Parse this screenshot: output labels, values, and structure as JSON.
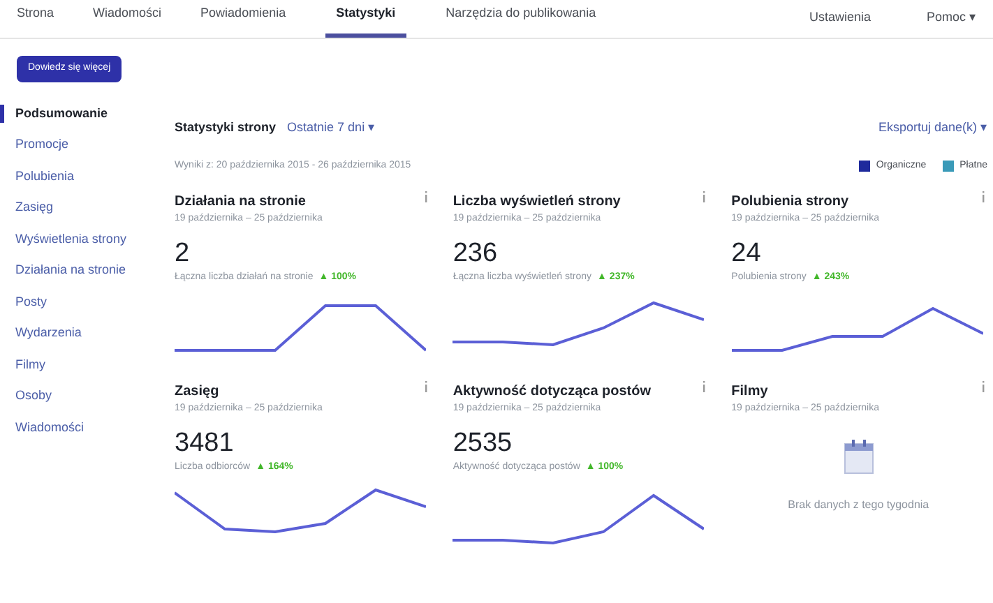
{
  "nav": {
    "tabs": [
      {
        "label": "Strona",
        "selected": false
      },
      {
        "label": "Wiadomości",
        "selected": false
      },
      {
        "label": "Powiadomienia",
        "selected": false
      },
      {
        "label": "Statystyki",
        "selected": true
      },
      {
        "label": "Narzędzia do publikowania",
        "selected": false
      }
    ],
    "right": [
      "Ustawienia",
      "Pomoc ▾"
    ]
  },
  "learn_more_button": "Dowiedz się więcej",
  "sidebar": {
    "items": [
      {
        "label": "Podsumowanie",
        "selected": true
      },
      {
        "label": "Promocje",
        "selected": false
      },
      {
        "label": "Polubienia",
        "selected": false
      },
      {
        "label": "Zasięg",
        "selected": false
      },
      {
        "label": "Wyświetlenia strony",
        "selected": false
      },
      {
        "label": "Działania na stronie",
        "selected": false
      },
      {
        "label": "Posty",
        "selected": false
      },
      {
        "label": "Wydarzenia",
        "selected": false
      },
      {
        "label": "Filmy",
        "selected": false
      },
      {
        "label": "Osoby",
        "selected": false
      },
      {
        "label": "Wiadomości",
        "selected": false
      }
    ]
  },
  "header": {
    "title": "Statystyki strony",
    "period": "Ostatnie 7 dni ▾",
    "export": "Eksportuj dane(k) ▾"
  },
  "date_range": "Wyniki z: 20 października 2015 - 26 października 2015",
  "legend": [
    {
      "label": "Organiczne",
      "color": "#1e2a9c"
    },
    {
      "label": "Płatne",
      "color": "#3a9ab8"
    }
  ],
  "cards": [
    {
      "kind": "sparkline",
      "title": "Działania na stronie",
      "dates": "19 października – 25 października",
      "value": "2",
      "caption": "Łączna liczba działań na stronie",
      "change": "▲ 100%"
    },
    {
      "kind": "sparkline",
      "title": "Liczba wyświetleń strony",
      "dates": "19 października – 25 października",
      "value": "236",
      "caption": "Łączna liczba wyświetleń strony",
      "change": "▲ 237%"
    },
    {
      "kind": "sparkline",
      "title": "Polubienia strony",
      "dates": "19 października – 25 października",
      "value": "24",
      "caption": "Polubienia strony",
      "change": "▲ 243%"
    },
    {
      "kind": "sparkline",
      "title": "Zasięg",
      "dates": "19 października – 25 października",
      "value": "3481",
      "caption": "Liczba odbiorców",
      "change": "▲ 164%"
    },
    {
      "kind": "sparkline",
      "title": "Aktywność dotycząca postów",
      "dates": "19 października – 25 października",
      "value": "2535",
      "caption": "Aktywność dotycząca postów",
      "change": "▲ 100%"
    },
    {
      "kind": "empty",
      "title": "Filmy",
      "dates": "19 października – 25 października",
      "message": "Brak danych z tego tygodnia"
    }
  ]
}
